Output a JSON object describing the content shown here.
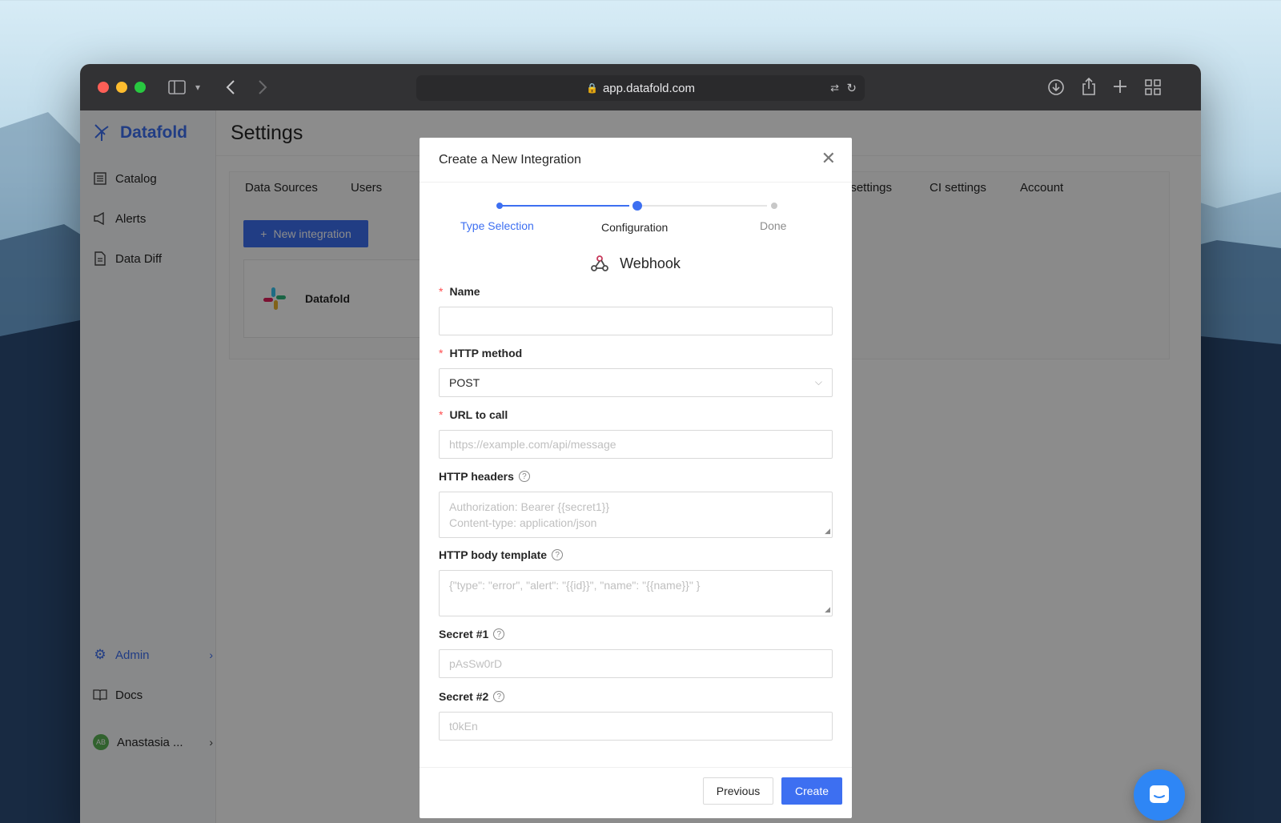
{
  "browser": {
    "url": "app.datafold.com"
  },
  "sidebar": {
    "brand": "Datafold",
    "items": [
      {
        "label": "Catalog",
        "icon": "catalog-icon"
      },
      {
        "label": "Alerts",
        "icon": "megaphone-icon"
      },
      {
        "label": "Data Diff",
        "icon": "document-icon"
      }
    ],
    "admin": "Admin",
    "docs": "Docs",
    "user": "Anastasia ...",
    "user_initials": "AB"
  },
  "settings": {
    "title": "Settings",
    "tabs": [
      "Data Sources",
      "Users",
      "t settings",
      "CI settings",
      "Account"
    ],
    "new_integration": "New integration",
    "integration_card": "Datafold"
  },
  "modal": {
    "title": "Create a New Integration",
    "steps": [
      "Type Selection",
      "Configuration",
      "Done"
    ],
    "current_step": 2,
    "integration_type": "Webhook",
    "fields": {
      "name": {
        "label": "Name",
        "value": ""
      },
      "method": {
        "label": "HTTP method",
        "value": "POST"
      },
      "url": {
        "label": "URL to call",
        "placeholder": "https://example.com/api/message"
      },
      "headers": {
        "label": "HTTP headers",
        "placeholder_line1": "Authorization: Bearer {{secret1}}",
        "placeholder_line2": "Content-type: application/json"
      },
      "body": {
        "label": "HTTP body template",
        "placeholder": "{\"type\": \"error\", \"alert\": \"{{id}}\", \"name\": \"{{name}}\" }"
      },
      "secret1": {
        "label": "Secret #1",
        "placeholder": "pAsSw0rD"
      },
      "secret2": {
        "label": "Secret #2",
        "placeholder": "t0kEn"
      }
    },
    "buttons": {
      "previous": "Previous",
      "create": "Create"
    }
  },
  "colors": {
    "accent": "#3d6ff1",
    "required": "#ff4d4f"
  }
}
